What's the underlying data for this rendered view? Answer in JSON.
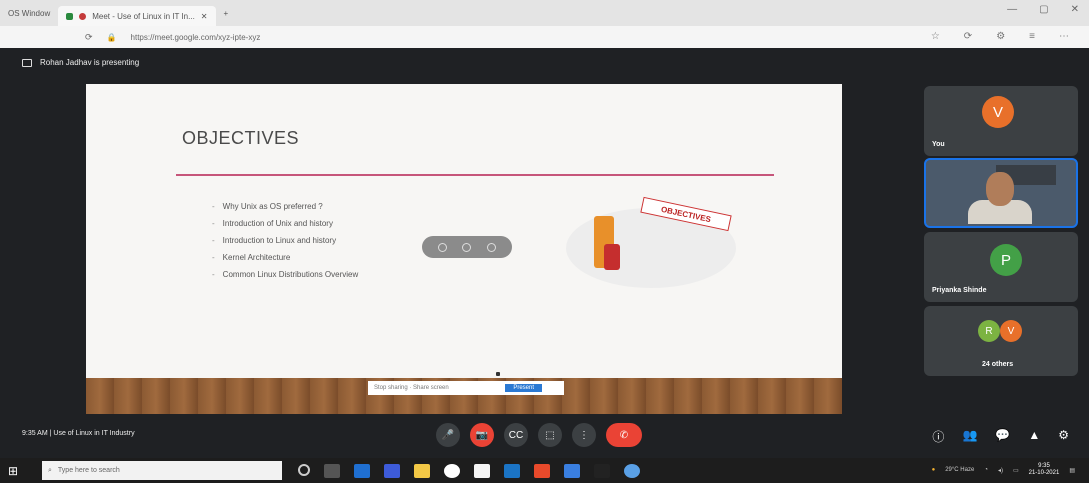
{
  "browser": {
    "tabs": [
      {
        "label": "OS Window"
      },
      {
        "label": "Meet - Use of Linux in IT In..."
      }
    ],
    "new_tab_symbol": "+",
    "url": "https://meet.google.com/xyz-ipte-xyz",
    "controls": [
      "—",
      "▢",
      "✕"
    ],
    "addr_icons": [
      "☆",
      "⟳",
      "⚙",
      "≡",
      "⋯"
    ]
  },
  "meet": {
    "presenter_label": "Rohan Jadhav is presenting",
    "slide": {
      "title": "OBJECTIVES",
      "bullets": [
        "Why Unix as OS preferred ?",
        "Introduction of Unix and history",
        "Introduction to Linux and history",
        "Kernel Architecture",
        "Common Linux Distributions Overview"
      ],
      "image_word": "OBJECTIVES",
      "caption_text": "Stop sharing · Share screen",
      "caption_button": "Present"
    },
    "tiles": [
      {
        "name": "You",
        "initial": "V",
        "color": "#e8702a"
      },
      {
        "name": "Rohan Jadhav"
      },
      {
        "name": "Priyanka Shinde",
        "initial": "P",
        "color": "#43a047"
      },
      {
        "name": "24 others",
        "initials": [
          "R",
          "V"
        ],
        "colors": [
          "#7cb342",
          "#e8702a"
        ]
      }
    ],
    "meeting_info": "9:35 AM | Use of Linux in IT Industry",
    "controls": [
      "🎤",
      "📷",
      "CC",
      "⬚",
      "⋮"
    ],
    "right_icons": [
      "ⓘ",
      "👥",
      "💬",
      "▲",
      "⚙"
    ]
  },
  "taskbar": {
    "search_placeholder": "Type here to search",
    "weather": "29°C Haze",
    "time": "9:35",
    "date": "21-10-2021"
  }
}
